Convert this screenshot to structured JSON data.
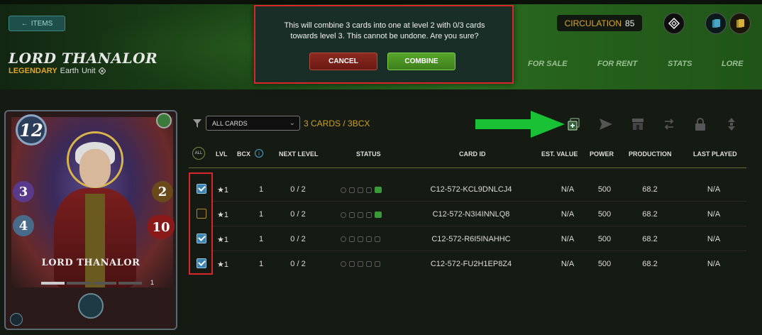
{
  "nav": {
    "back_label": "ITEMS"
  },
  "card": {
    "name": "LORD THANALOR",
    "rarity": "LEGENDARY",
    "element": "Earth",
    "type": "Unit",
    "mana": "12",
    "magic": "3",
    "armor": "4",
    "speed": "2",
    "health": "10",
    "art_name": "LORD THANALOR",
    "level": "1",
    "level_progress_segments": 4,
    "level_progress_filled": 1
  },
  "circulation": {
    "label": "CIRCULATION",
    "value": "85"
  },
  "header_icons": [
    "splinterlands-diamond-icon",
    "card-deck-blue-icon",
    "card-deck-gold-icon"
  ],
  "tabs": [
    "FOR SALE",
    "FOR RENT",
    "STATS",
    "LORE"
  ],
  "dialog": {
    "message": "This will combine 3 cards into one at level 2 with 0/3 cards towards level 3. This cannot be undone. Are you sure?",
    "cancel_label": "CANCEL",
    "combine_label": "COMBINE"
  },
  "filter": {
    "selected": "ALL CARDS",
    "summary": "3 CARDS / 3BCX"
  },
  "toolbar_icons": [
    "combine-icon",
    "send-icon",
    "market-icon",
    "transfer-icon",
    "lock-icon",
    "delegate-icon"
  ],
  "table": {
    "all_label": "ALL",
    "columns": [
      "LVL",
      "BCX",
      "NEXT LEVEL",
      "STATUS",
      "CARD ID",
      "EST. VALUE",
      "POWER",
      "PRODUCTION",
      "LAST PLAYED"
    ],
    "rows": [
      {
        "checked": true,
        "lvl": "★1",
        "bcx": "1",
        "next": "0 / 2",
        "id": "C12-572-KCL9DNLCJ4",
        "value": "N/A",
        "power": "500",
        "production": "68.2",
        "last": "N/A"
      },
      {
        "checked": false,
        "lvl": "★1",
        "bcx": "1",
        "next": "0 / 2",
        "id": "C12-572-N3I4INNLQ8",
        "value": "N/A",
        "power": "500",
        "production": "68.2",
        "last": "N/A"
      },
      {
        "checked": true,
        "lvl": "★1",
        "bcx": "1",
        "next": "0 / 2",
        "id": "C12-572-R6I5INAHHC",
        "value": "N/A",
        "power": "500",
        "production": "68.2",
        "last": "N/A"
      },
      {
        "checked": true,
        "lvl": "★1",
        "bcx": "1",
        "next": "0 / 2",
        "id": "C12-572-FU2H1EP8Z4",
        "value": "N/A",
        "power": "500",
        "production": "68.2",
        "last": "N/A"
      }
    ]
  },
  "colors": {
    "accent_gold": "#e0a52a",
    "highlight_red": "#d9262a",
    "arrow_green": "#18c234",
    "combine_green": "#57a52a",
    "cancel_red": "#8c2a20"
  }
}
